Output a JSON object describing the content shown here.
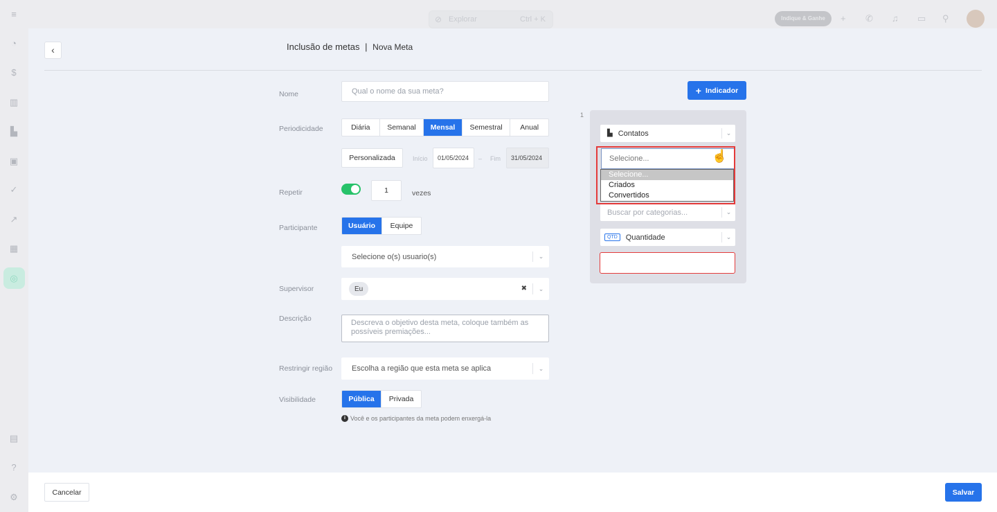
{
  "app": {
    "explore_label": "Explorar",
    "explore_shortcut": "Ctrl + K",
    "indique_label": "Indique & Ganhe"
  },
  "header": {
    "title": "Inclusão de metas",
    "separator": "|",
    "subtitle": "Nova Meta"
  },
  "form": {
    "nome": {
      "label": "Nome",
      "placeholder": "Qual o nome da sua meta?"
    },
    "periodicidade": {
      "label": "Periodicidade",
      "options": [
        "Diária",
        "Semanal",
        "Mensal",
        "Semestral",
        "Anual"
      ],
      "selected": "Mensal",
      "custom_label": "Personalizada",
      "inicio_label": "Início",
      "inicio_value": "01/05/2024",
      "range_sep": "–",
      "fim_label": "Fim",
      "fim_value": "31/05/2024"
    },
    "repetir": {
      "label": "Repetir",
      "enabled": true,
      "value": "1",
      "suffix": "vezes"
    },
    "participante": {
      "label": "Participante",
      "options": [
        "Usuário",
        "Equipe"
      ],
      "selected": "Usuário",
      "select_placeholder": "Selecione o(s) usuario(s)"
    },
    "supervisor": {
      "label": "Supervisor",
      "chip": "Eu",
      "clear_icon": "✖"
    },
    "descricao": {
      "label": "Descrição",
      "placeholder": "Descreva o objetivo desta meta, coloque também as possíveis premiações..."
    },
    "regiao": {
      "label": "Restringir região",
      "placeholder": "Escolha a região que esta meta se aplica"
    },
    "visibilidade": {
      "label": "Visibilidade",
      "options": [
        "Pública",
        "Privada"
      ],
      "selected": "Pública",
      "info": "Você e os participantes da meta podem enxergá-la"
    }
  },
  "indicator": {
    "add_label": "Indicador",
    "number": "1",
    "entity": "Contatos",
    "type_select": {
      "value": "Selecione...",
      "options": [
        "Selecione...",
        "Criados",
        "Convertidos"
      ],
      "highlighted": "Selecione..."
    },
    "category_placeholder": "Buscar por categorias...",
    "metric_badge": "QTD",
    "metric": "Quantidade"
  },
  "footer": {
    "cancel_label": "Cancelar",
    "save_label": "Salvar"
  },
  "colors": {
    "primary": "#2673ea",
    "toggle_on": "#27c26a",
    "error": "#e43a3a"
  }
}
